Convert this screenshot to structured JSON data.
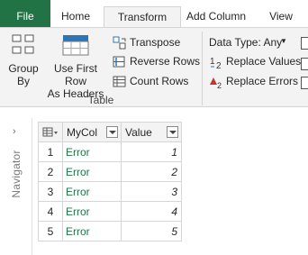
{
  "tabs": {
    "file": "File",
    "home": "Home",
    "transform": "Transform",
    "add_column": "Add Column",
    "view": "View"
  },
  "ribbon": {
    "table_group": {
      "label": "Table",
      "group_by": [
        "Group",
        "By"
      ],
      "use_first_row": [
        "Use First Row",
        "As Headers"
      ],
      "transpose": "Transpose",
      "reverse_rows": "Reverse Rows",
      "count_rows": "Count Rows"
    },
    "any_column_group": {
      "data_type": "Data Type: Any",
      "replace_values": "Replace Values",
      "replace_errors": "Replace Errors"
    }
  },
  "navigator": {
    "label": "Navigator"
  },
  "grid": {
    "columns": [
      "MyCol",
      "Value"
    ],
    "rows": [
      {
        "index": "1",
        "mycol": "Error",
        "value": "1"
      },
      {
        "index": "2",
        "mycol": "Error",
        "value": "2"
      },
      {
        "index": "3",
        "mycol": "Error",
        "value": "3"
      },
      {
        "index": "4",
        "mycol": "Error",
        "value": "4"
      },
      {
        "index": "5",
        "mycol": "Error",
        "value": "5"
      }
    ]
  },
  "colors": {
    "file_tab": "#217346",
    "error_text": "#217346",
    "ribbon_bg": "#f3f3f3",
    "accent_blue": "#2e75b6",
    "accent_red": "#c0392b"
  }
}
